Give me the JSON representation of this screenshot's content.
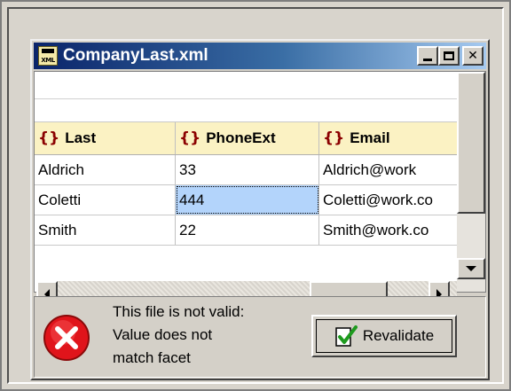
{
  "window": {
    "title": "CompanyLast.xml",
    "icon_label": "XML",
    "icon": "xml-file-icon"
  },
  "titlebar_buttons": [
    "minimize",
    "maximize",
    "close"
  ],
  "grid": {
    "columns": [
      {
        "label": "Last",
        "icon": "element-brace-icon"
      },
      {
        "label": "PhoneExt",
        "icon": "element-brace-icon"
      },
      {
        "label": "Email",
        "icon": "element-brace-icon"
      }
    ],
    "rows": [
      [
        "Aldrich",
        "33",
        "Aldrich@work"
      ],
      [
        "Coletti",
        "444",
        "Coletti@work.co"
      ],
      [
        "Smith",
        "22",
        "Smith@work.co"
      ]
    ],
    "brace_glyph": "{}",
    "selected_cell": {
      "row": 1,
      "col": 1
    }
  },
  "status": {
    "line1": "This file is not valid:",
    "line2": "Value does not",
    "line3": "match facet",
    "icon": "error-x-icon"
  },
  "revalidate_button": {
    "label": "Revalidate",
    "icon": "revalidate-check-icon"
  },
  "colors": {
    "title_start": "#0a246a",
    "title_end": "#a6caf0",
    "header_bg": "#fbf2c3",
    "brace": "#8b0000",
    "selection": "#b3d4fb",
    "error_red": "#e0141b",
    "check_green": "#1e9a1e"
  }
}
